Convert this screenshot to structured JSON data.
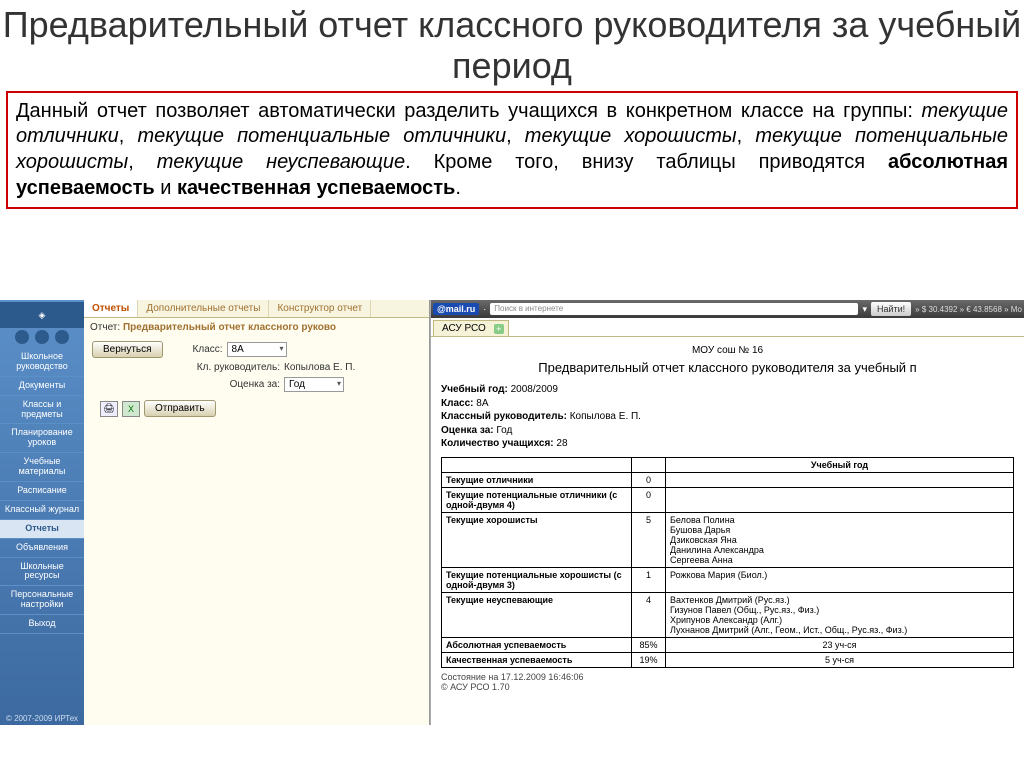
{
  "slide": {
    "title": "Предварительный отчет классного руководителя за учебный период",
    "desc_p1": "Данный отчет позволяет автоматически разделить учащихся в конкретном классе на группы: ",
    "desc_groups": [
      "текущие отличники",
      "текущие потенциальные отличники",
      "текущие хорошисты",
      "текущие потенциальные хорошисты",
      "текущие неуспевающие"
    ],
    "desc_p2": ". Кроме того, внизу таблицы приводятся ",
    "desc_b1": "абсолютная успеваемость",
    "desc_and": " и ",
    "desc_b2": "качественная успеваемость",
    "desc_end": "."
  },
  "sidebar": {
    "items": [
      {
        "label": "Школьное руководство"
      },
      {
        "label": "Документы"
      },
      {
        "label": "Классы и предметы"
      },
      {
        "label": "Планирование уроков"
      },
      {
        "label": "Учебные материалы"
      },
      {
        "label": "Расписание"
      },
      {
        "label": "Классный журнал"
      },
      {
        "label": "Отчеты"
      },
      {
        "label": "Объявления"
      },
      {
        "label": "Школьные ресурсы"
      },
      {
        "label": "Персональные настройки"
      },
      {
        "label": "Выход"
      }
    ],
    "active_index": 7,
    "footer": "© 2007-2009 ИРТех"
  },
  "tabs": {
    "items": [
      "Отчеты",
      "Дополнительные отчеты",
      "Конструктор отчет"
    ],
    "active_index": 0
  },
  "form": {
    "head_label": "Отчет:",
    "head_value": "Предварительный отчет классного руково",
    "back_btn": "Вернуться",
    "class_label": "Класс:",
    "class_value": "8А",
    "teacher_label": "Кл. руководитель:",
    "teacher_value": "Копылова Е. П.",
    "grade_label": "Оценка за:",
    "grade_value": "Год",
    "send_btn": "Отправить"
  },
  "mailru": {
    "logo": "@mail.ru",
    "search_placeholder": "Поиск в интернете",
    "find": "Найти!",
    "ticker": "» $ 30.4392  » € 43.8568  » Мо"
  },
  "report": {
    "tab": "АСУ РСО",
    "school": "МОУ сош № 16",
    "title": "Предварительный отчет классного руководителя за учебный п",
    "meta": [
      {
        "k": "Учебный год:",
        "v": "2008/2009"
      },
      {
        "k": "Класс:",
        "v": "8А"
      },
      {
        "k": "Классный руководитель:",
        "v": "Копылова Е. П."
      },
      {
        "k": "Оценка за:",
        "v": "Год"
      },
      {
        "k": "Количество учащихся:",
        "v": "28"
      }
    ],
    "col_header": "Учебный год",
    "rows": [
      {
        "cat": "Текущие отличники",
        "n": "0",
        "detail": ""
      },
      {
        "cat": "Текущие потенциальные отличники (с одной-двумя 4)",
        "n": "0",
        "detail": ""
      },
      {
        "cat": "Текущие хорошисты",
        "n": "5",
        "detail": "Белова Полина\nБушова Дарья\nДзиковская Яна\nДанилина Александра\nСергеева Анна"
      },
      {
        "cat": "Текущие потенциальные хорошисты (с одной-двумя 3)",
        "n": "1",
        "detail": "Рожкова Мария (Биол.)"
      },
      {
        "cat": "Текущие неуспевающие",
        "n": "4",
        "detail": "Вахтенков Дмитрий (Рус.яз.)\nГизунов Павел (Общ., Рус.яз., Физ.)\nХрипунов Александр (Алг.)\nЛухнанов Дмитрий (Алг., Геом., Ист., Общ., Рус.яз., Физ.)"
      }
    ],
    "summary": [
      {
        "cat": "Абсолютная успеваемость",
        "n": "85%",
        "detail": "23 уч-ся"
      },
      {
        "cat": "Качественная успеваемость",
        "n": "19%",
        "detail": "5 уч-ся"
      }
    ],
    "footer1": "Состояние на 17.12.2009 16:46:06",
    "footer2": "© АСУ РСО 1.70"
  }
}
